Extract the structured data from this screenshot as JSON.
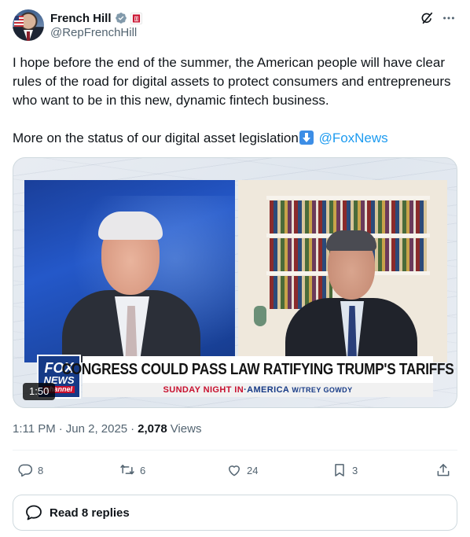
{
  "author": {
    "name": "French Hill",
    "handle": "@RepFrenchHill"
  },
  "tweet": {
    "line1": "I hope before the end of the summer, the American people will have clear rules of the road for digital assets to protect consumers and entrepreneurs who want to be in this new, dynamic fintech business.",
    "line2_prefix": "More on the status of our digital asset legislation",
    "mention": "@FoxNews"
  },
  "media": {
    "logo_line1": "FOX",
    "logo_line2": "NEWS",
    "logo_line3": "channel",
    "headline": "CONGRESS COULD PASS LAW RATIFYING TRUMP'S TARIFFS",
    "subline_part1": "SUNDAY NIGHT IN",
    "subline_part2": "·AMERICA",
    "subline_part3": "W/TREY GOWDY",
    "duration": "1:50"
  },
  "meta": {
    "time": "1:11 PM",
    "separator": "·",
    "date": "Jun 2, 2025",
    "separator2": "·",
    "views_count": "2,078",
    "views_label": "Views"
  },
  "actions": {
    "replies": "8",
    "reposts": "6",
    "likes": "24",
    "bookmarks": "3"
  },
  "read_replies": "Read 8 replies",
  "colors": {
    "accent": "#1d9bf0",
    "muted": "#536471",
    "text": "#0f1419"
  },
  "icons": [
    "verified-badge-icon",
    "government-affiliation-icon",
    "grok-icon",
    "more-icon",
    "reply-icon",
    "repost-icon",
    "like-icon",
    "bookmark-icon",
    "share-icon",
    "speech-bubble-icon",
    "down-arrow-emoji-icon"
  ]
}
